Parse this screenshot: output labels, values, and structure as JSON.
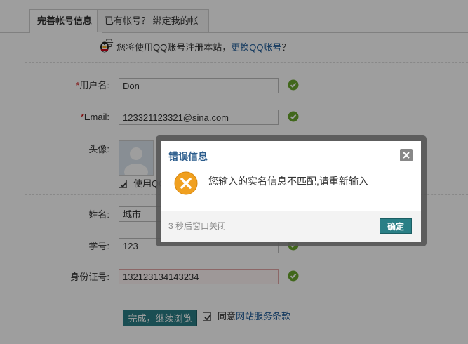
{
  "tabs": [
    {
      "label": "完善帐号信息",
      "active": true
    },
    {
      "label": "已有帐号？ 绑定我的帐号",
      "active": false
    }
  ],
  "qq_notice": {
    "text": "您将使用QQ账号注册本站，",
    "link": "更换QQ账号",
    "suffix": "？"
  },
  "form": {
    "username": {
      "required_mark": "*",
      "label": "用户名:",
      "value": "Don"
    },
    "email": {
      "required_mark": "*",
      "label": "Email:",
      "value": "123321123321@sina.com"
    },
    "avatar": {
      "label": "头像:",
      "checkbox_label": "使用QQ"
    },
    "name": {
      "label": "姓名:",
      "value": "城市"
    },
    "student_id": {
      "label": "学号:",
      "value": "123"
    },
    "id_number": {
      "label": "身份证号:",
      "value": "132123134143234"
    }
  },
  "submit_label": "完成，继续浏览",
  "agree": {
    "text": "同意",
    "link": "网站服务条款"
  },
  "dialog": {
    "title": "错误信息",
    "message": "您输入的实名信息不匹配,请重新输入",
    "countdown": "3 秒后窗口关闭",
    "ok_label": "确定"
  },
  "colors": {
    "accent": "#2a7f86",
    "link": "#1f5c99",
    "title": "#2b5c8c",
    "error_icon": "#f0a020",
    "check_icon": "#6aa72c"
  }
}
